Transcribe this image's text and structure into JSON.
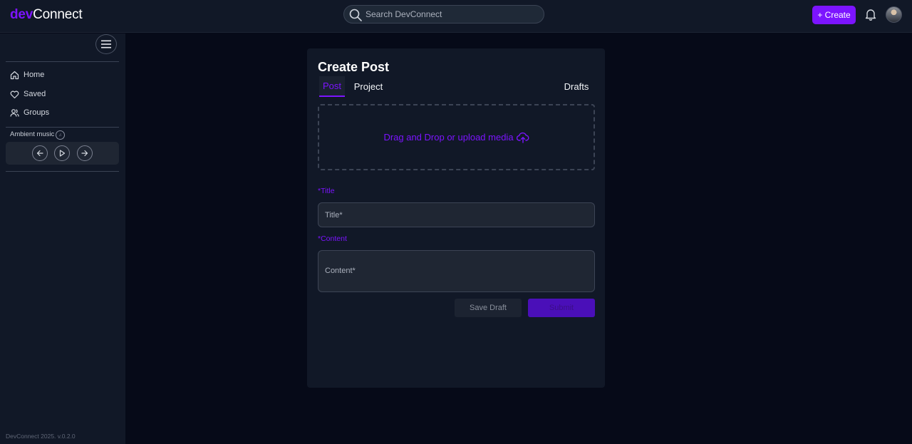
{
  "header": {
    "logo_dev": "dev",
    "logo_connect": "Connect",
    "search_placeholder": "Search DevConnect",
    "create_label": "+ Create"
  },
  "sidebar": {
    "items": [
      {
        "label": "Home",
        "icon": "home-icon"
      },
      {
        "label": "Saved",
        "icon": "heart-icon"
      },
      {
        "label": "Groups",
        "icon": "users-icon"
      }
    ],
    "ambient_label": "Ambient music",
    "version": "DevConnect 2025. v.0.2.0"
  },
  "post_form": {
    "title": "Create Post",
    "tabs": [
      {
        "label": "Post",
        "active": true
      },
      {
        "label": "Project",
        "active": false
      }
    ],
    "drafts_label": "Drafts",
    "dropzone_text": "Drag and Drop or upload media",
    "title_label": "*Title",
    "title_placeholder": "Title*",
    "content_label": "*Content",
    "content_placeholder": "Content*",
    "save_draft_label": "Save Draft",
    "submit_label": "Submit"
  },
  "colors": {
    "accent": "#7c14ff",
    "background": "#060a18",
    "panel": "#111827"
  }
}
